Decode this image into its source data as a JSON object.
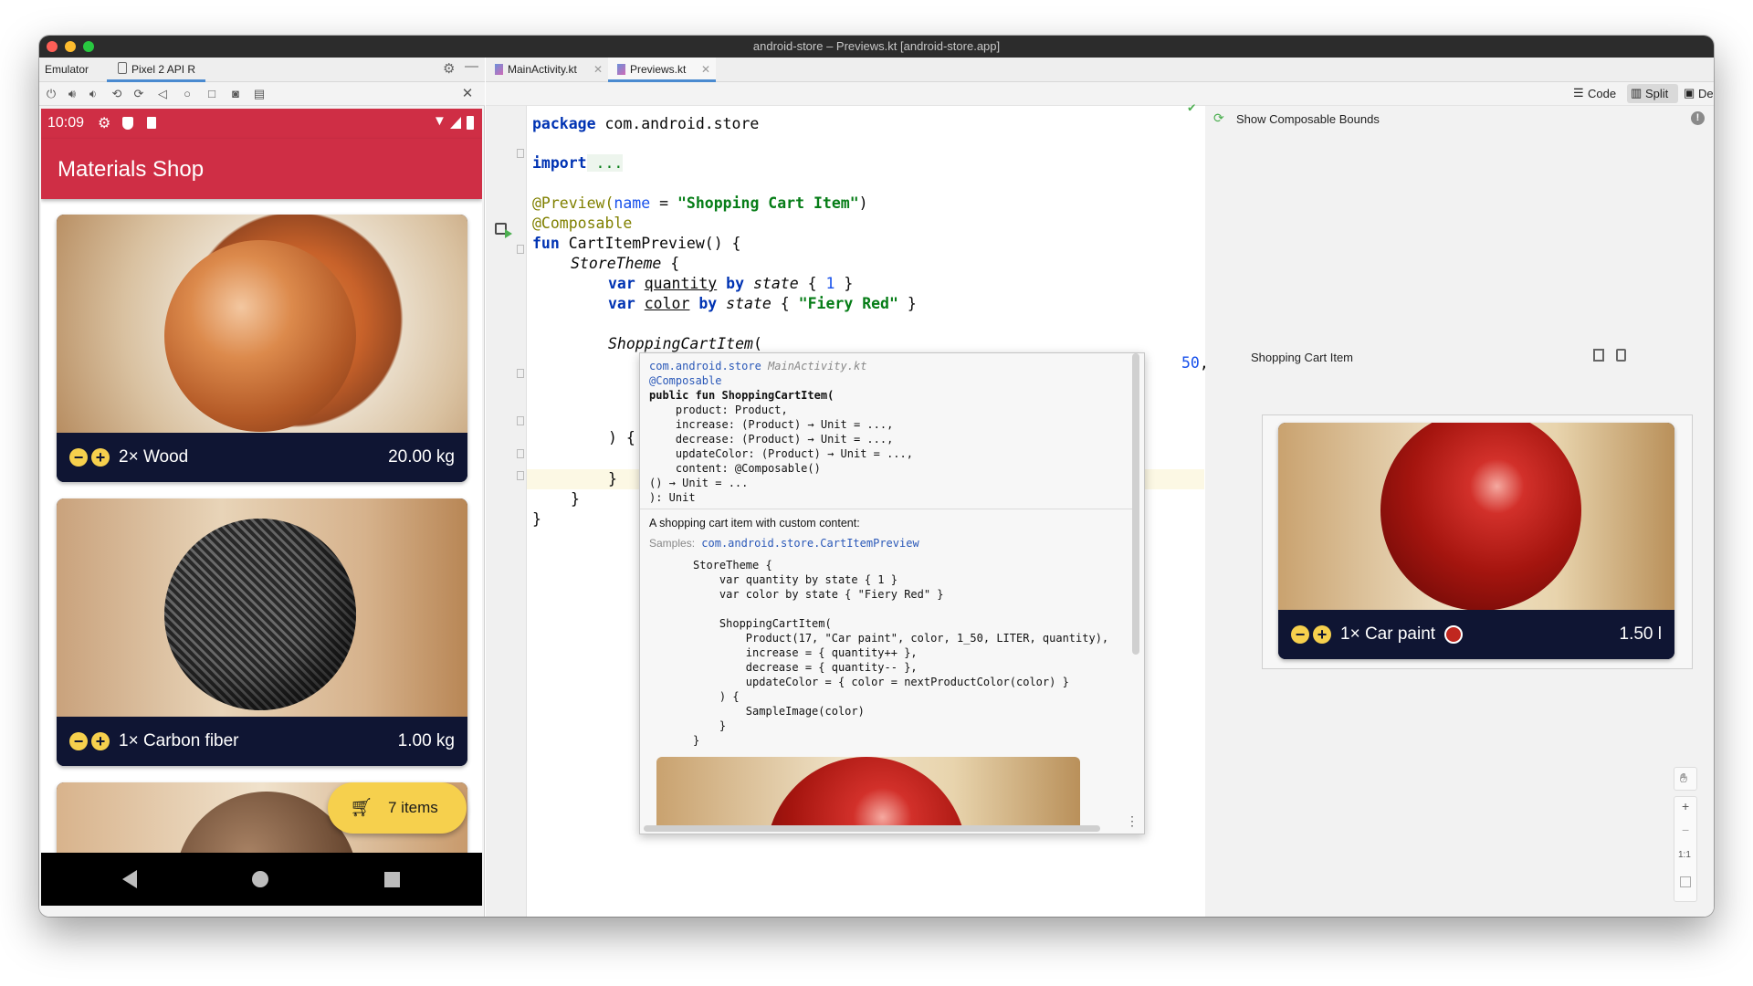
{
  "window": {
    "title": "android-store – Previews.kt [android-store.app]"
  },
  "emulator": {
    "tab_label": "Emulator",
    "device_tab": "Pixel 2 API R",
    "toolbar_icons": [
      "power-icon",
      "volume-up-icon",
      "volume-down-icon",
      "rotate-left-icon",
      "rotate-right-icon",
      "back-icon",
      "home-icon",
      "overview-icon",
      "camera-icon",
      "snapshot-icon"
    ],
    "phone": {
      "time": "10:09",
      "app_title": "Materials Shop",
      "items": [
        {
          "name": "2× Wood",
          "weight": "20.00 kg"
        },
        {
          "name": "1× Carbon fiber",
          "weight": "1.00 kg"
        }
      ],
      "cart_button": "7 items",
      "cart_icon": "cart-icon"
    }
  },
  "editor": {
    "tabs": [
      {
        "label": "MainActivity.kt",
        "active": false
      },
      {
        "label": "Previews.kt",
        "active": true
      }
    ],
    "view_modes": {
      "code": "Code",
      "split": "Split",
      "design": "Design",
      "active": "Split"
    },
    "code_lines": {
      "l1_kw": "package",
      "l1_rest": " com.android.store",
      "l2_kw": "import",
      "l2_rest": " ...",
      "l3_ann": "@Preview(",
      "l3_param": "name",
      "l3_eq": " = ",
      "l3_str": "\"Shopping Cart Item\"",
      "l3_close": ")",
      "l4_ann": "@Composable",
      "l5_kw": "fun",
      "l5_rest": " CartItemPreview() {",
      "l6_fn": "StoreTheme",
      "l6_rest": " {",
      "l7_kw": "var",
      "l7_name": "quantity",
      "l7_by": " by ",
      "l7_state": "state",
      "l7_open": " { ",
      "l7_val": "1",
      "l7_close": " }",
      "l8_kw": "var",
      "l8_name": "color",
      "l8_by": " by ",
      "l8_state": "state",
      "l8_open": " { ",
      "l8_val": "\"Fiery Red\"",
      "l8_close": " }",
      "l9_fn": "ShoppingCartItem",
      "l9_rest": "(",
      "l10_tail": "50",
      "l10_comma": ",",
      "l11": ") {",
      "l12": "}",
      "l13": "}",
      "l14": "}"
    },
    "doc_popup": {
      "header_pkg": "com.android.store",
      "header_file": "MainActivity.kt",
      "sig": [
        "@Composable",
        "public fun ShoppingCartItem(",
        "    product: Product,",
        "    increase: (Product) → Unit = ...,",
        "    decrease: (Product) → Unit = ...,",
        "    updateColor: (Product) → Unit = ...,",
        "    content: @Composable()",
        "() → Unit = ...",
        "): Unit"
      ],
      "description": "A shopping cart item with custom content:",
      "samples_label": "Samples:",
      "samples_link": "com.android.store.CartItemPreview",
      "sample_code": [
        "StoreTheme {",
        "    var quantity by state { 1 }",
        "    var color by state { \"Fiery Red\" }",
        "",
        "    ShoppingCartItem(",
        "        Product(17, \"Car paint\", color, 1_50, LITER, quantity),",
        "        increase = { quantity++ },",
        "        decrease = { quantity-- },",
        "        updateColor = { color = nextProductColor(color) }",
        "    ) {",
        "        SampleImage(color)",
        "    }",
        "}"
      ]
    },
    "design": {
      "show_bounds": "Show Composable Bounds",
      "preview_title": "Shopping Cart Item",
      "preview_item": {
        "name": "1× Car paint",
        "volume": "1.50 l",
        "color_hex": "#c0271f"
      },
      "zoom_fit": "1:1"
    }
  },
  "colors": {
    "accent_red": "#cf2e45",
    "navy": "#0f1533",
    "yellow": "#f6d04d"
  }
}
